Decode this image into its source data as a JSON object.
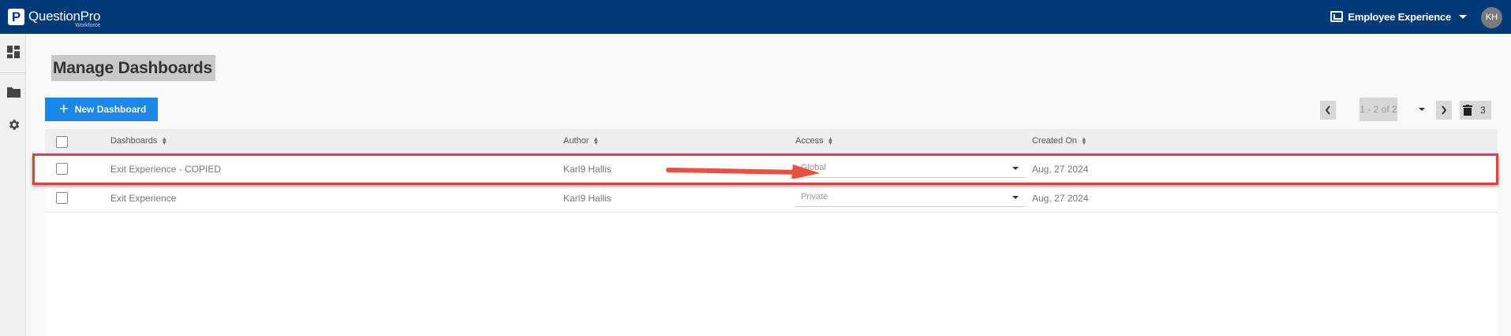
{
  "topbar": {
    "logo_mark": "P",
    "logo_text": "QuestionPro",
    "logo_sub": "Workforce",
    "product_label": "Employee Experience",
    "avatar_initials": "KH"
  },
  "sidebar": {
    "items": [
      {
        "icon": "dashboard-icon"
      },
      {
        "icon": "folder-icon"
      },
      {
        "icon": "gear-icon"
      }
    ]
  },
  "page": {
    "title": "Manage Dashboards",
    "new_button_label": "New Dashboard"
  },
  "pager": {
    "range_text": "1 - 2 of 2",
    "trash_count": "3"
  },
  "table": {
    "columns": {
      "dashboards": "Dashboards",
      "author": "Author",
      "access": "Access",
      "created_on": "Created On"
    },
    "rows": [
      {
        "name": "Exit Experience - COPIED",
        "author": "Karl9 Hallis",
        "access": "Global",
        "created_on": "Aug, 27 2024",
        "highlighted": true
      },
      {
        "name": "Exit Experience",
        "author": "Karl9 Hallis",
        "access": "Private",
        "created_on": "Aug, 27 2024",
        "highlighted": false
      }
    ]
  },
  "colors": {
    "topbar": "#003a78",
    "primary_button": "#1b87e6",
    "highlight": "#d9453a",
    "arrow": "#e8503f"
  }
}
